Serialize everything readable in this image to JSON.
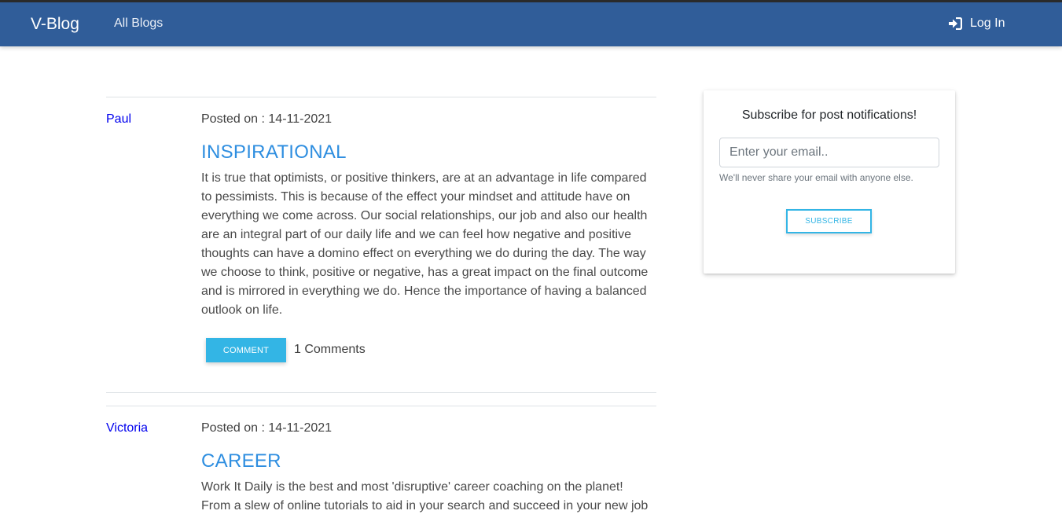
{
  "navbar": {
    "brand": "V-Blog",
    "links": [
      "All Blogs"
    ],
    "login_label": "Log In",
    "login_icon": "sign-in-icon",
    "background": "#305d99"
  },
  "posts": [
    {
      "author": "Paul",
      "posted_on": "Posted on : 14-11-2021",
      "title": "INSPIRATIONAL",
      "body": "It is true that optimists, or positive thinkers, are at an advantage in life compared to pessimists. This is because of the effect your mindset and attitude have on everything we come across. Our social relationships, our job and also our health are an integral part of our daily life and we can feel how negative and positive thoughts can have a domino effect on everything we do during the day. The way we choose to think, positive or negative, has a great impact on the final outcome and is mirrored in everything we do. Hence the importance of having a balanced outlook on life.",
      "comment_button": "COMMENT",
      "comments_count": "1 Comments"
    },
    {
      "author": "Victoria",
      "posted_on": "Posted on : 14-11-2021",
      "title": "CAREER",
      "body": "Work It Daily is the best and most 'disruptive' career coaching on the planet! From a slew of online tutorials to aid in your search and succeed in your new job and"
    }
  ],
  "subscribe": {
    "title": "Subscribe for post notifications!",
    "email_placeholder": "Enter your email..",
    "help_text": "We'll never share your email with anyone else.",
    "button": "SUBSCRIBE"
  },
  "colors": {
    "accent": "#33b5e5",
    "title_blue": "#2e8ee0",
    "author_link": "#0000ee"
  }
}
